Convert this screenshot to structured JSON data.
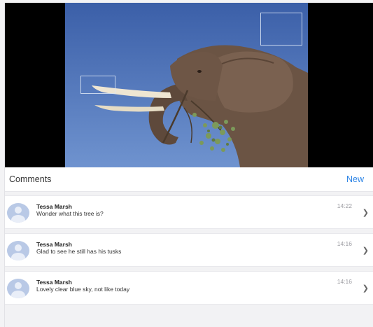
{
  "header": {
    "title": "Comments",
    "new_label": "New"
  },
  "comments": [
    {
      "author": "Tessa Marsh",
      "text": "Wonder what this tree is?",
      "time": "14:22"
    },
    {
      "author": "Tessa Marsh",
      "text": "Glad to see he still has his tusks",
      "time": "14:16"
    },
    {
      "author": "Tessa Marsh",
      "text": "Lovely clear blue sky, not like today",
      "time": "14:16"
    }
  ],
  "icons": {
    "avatar": "person-silhouette-icon",
    "chevron": "chevron-right-icon"
  },
  "colors": {
    "accent": "#2f86e6",
    "sky": "#4a6fb5",
    "avatar": "#b9c9e6"
  }
}
